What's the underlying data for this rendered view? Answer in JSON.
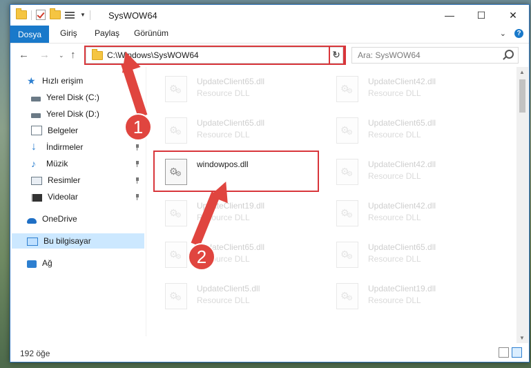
{
  "window": {
    "title": "SysWOW64"
  },
  "ribbon": {
    "tabs": [
      "Dosya",
      "Giriş",
      "Paylaş",
      "Görünüm"
    ]
  },
  "nav": {
    "address": "C:\\Windows\\SysWOW64",
    "search_placeholder": "Ara: SysWOW64"
  },
  "sidebar": {
    "items": [
      {
        "label": "Hızlı erişim",
        "icon": "star-icon"
      },
      {
        "label": "Yerel Disk (C:)",
        "icon": "drive-icon"
      },
      {
        "label": "Yerel Disk (D:)",
        "icon": "drive-icon"
      },
      {
        "label": "Belgeler",
        "icon": "documents-icon"
      },
      {
        "label": "İndirmeler",
        "icon": "download-icon"
      },
      {
        "label": "Müzik",
        "icon": "music-icon"
      },
      {
        "label": "Resimler",
        "icon": "pictures-icon"
      },
      {
        "label": "Videolar",
        "icon": "videos-icon"
      },
      {
        "label": "OneDrive",
        "icon": "onedrive-icon"
      },
      {
        "label": "Bu bilgisayar",
        "icon": "computer-icon"
      },
      {
        "label": "Ağ",
        "icon": "network-icon"
      }
    ]
  },
  "files": [
    {
      "name": "UpdateClient65.dll",
      "type": "Resource DLL"
    },
    {
      "name": "UpdateClient42.dll",
      "type": "Resource DLL"
    },
    {
      "name": "UpdateClient65.dll",
      "type": "Resource DLL"
    },
    {
      "name": "UpdateClient65.dll",
      "type": "Resource DLL"
    },
    {
      "name": "windowpos.dll",
      "type": ""
    },
    {
      "name": "UpdateClient42.dll",
      "type": "Resource DLL"
    },
    {
      "name": "UpdateClient19.dll",
      "type": "Resource DLL"
    },
    {
      "name": "UpdateClient42.dll",
      "type": "Resource DLL"
    },
    {
      "name": "UpdateClient65.dll",
      "type": "Resource DLL"
    },
    {
      "name": "UpdateClient65.dll",
      "type": "Resource DLL"
    },
    {
      "name": "UpdateClient5.dll",
      "type": "Resource DLL"
    },
    {
      "name": "UpdateClient19.dll",
      "type": "Resource DLL"
    }
  ],
  "annotations": {
    "step1": "1",
    "step2": "2"
  },
  "status": {
    "count": "192 öğe"
  },
  "colors": {
    "accent": "#1979ca",
    "highlight": "#d8353a",
    "selection": "#cce8ff"
  }
}
